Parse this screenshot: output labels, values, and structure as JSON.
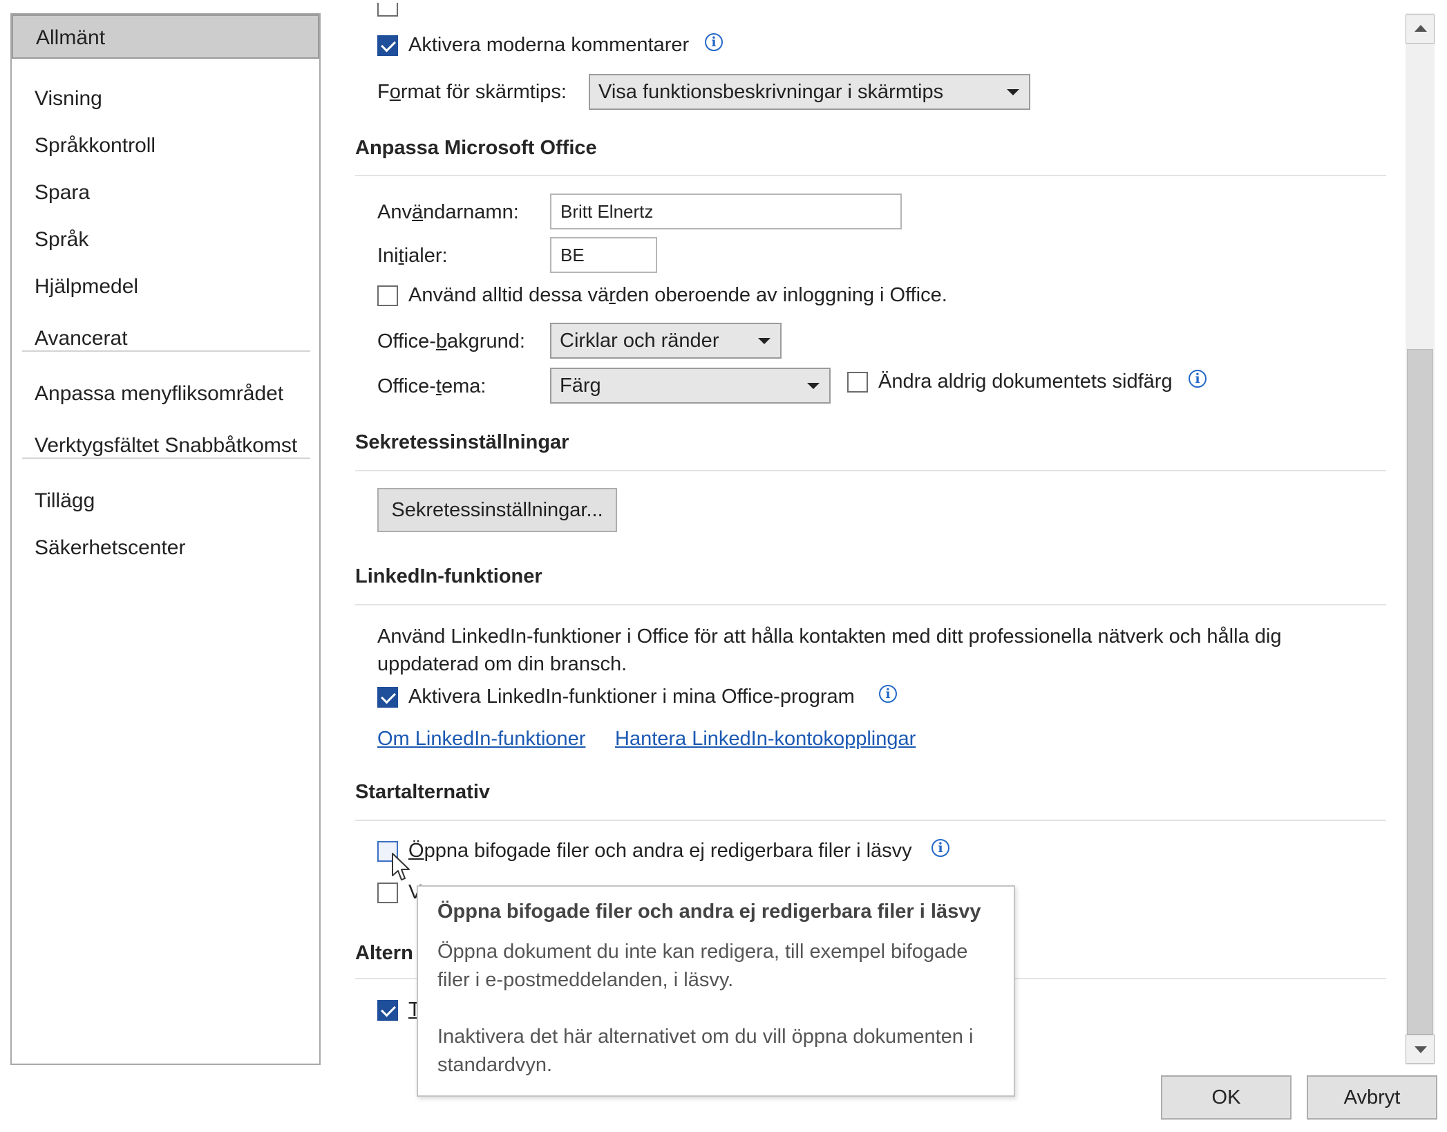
{
  "sidebar": {
    "items": [
      {
        "label": "Allmänt"
      },
      {
        "label": "Visning"
      },
      {
        "label": "Språkkontroll"
      },
      {
        "label": "Spara"
      },
      {
        "label": "Språk"
      },
      {
        "label": "Hjälpmedel"
      },
      {
        "label": "Avancerat"
      },
      {
        "label": "Anpassa menyfliksområdet"
      },
      {
        "label": "Verktygsfältet Snabbåtkomst"
      },
      {
        "label": "Tillägg"
      },
      {
        "label": "Säkerhetscenter"
      }
    ],
    "active_index": 0
  },
  "top": {
    "modern_comments_label": "Aktivera moderna kommentarer",
    "modern_comments_checked": true,
    "screentip_label_pre": "F",
    "screentip_label_key": "o",
    "screentip_label_post": "rmat för skärmtips:",
    "screentip_value": "Visa funktionsbeskrivningar i skärmtips"
  },
  "personalize": {
    "title": "Anpassa Microsoft Office",
    "username_pre": "Anv",
    "username_key": "ä",
    "username_post": "ndarnamn:",
    "username_value": "Britt Elnertz",
    "initials_pre": "Ini",
    "initials_key": "t",
    "initials_post": "ialer:",
    "initials_value": "BE",
    "always_use_pre": "Använd alltid dessa vä",
    "always_use_key": "r",
    "always_use_post": "den oberoende av inloggning i Office.",
    "always_use_checked": false,
    "background_pre": "Office-",
    "background_key": "b",
    "background_post": "akgrund:",
    "background_value": "Cirklar och ränder",
    "theme_pre": "Office-",
    "theme_key": "t",
    "theme_post": "ema:",
    "theme_value": "Färg",
    "never_change_label": "Ändra aldrig dokumentets sidfärg",
    "never_change_checked": false
  },
  "privacy": {
    "title": "Sekretessinställningar",
    "button_label": "Sekretessinställningar..."
  },
  "linkedin": {
    "title": "LinkedIn-funktioner",
    "description_line1": "Använd LinkedIn-funktioner i Office för att hålla kontakten med ditt professionella nätverk och hålla dig",
    "description_line2": "uppdaterad om din bransch.",
    "enable_label": "Aktivera LinkedIn-funktioner i mina Office-program",
    "enable_checked": true,
    "link_about": "Om LinkedIn-funktioner",
    "link_manage": "Hantera LinkedIn-kontokopplingar"
  },
  "startup": {
    "title": "Startalternativ",
    "open_readonly_key": "Ö",
    "open_readonly_post": "ppna bifogade filer och andra ej redigerbara filer i läsvy",
    "open_readonly_checked": false,
    "second_option_partial": "V",
    "second_option_checked": false
  },
  "alternatives": {
    "title_partial": "Altern",
    "option_partial": "T",
    "option_checked": true
  },
  "tooltip": {
    "title": "Öppna bifogade filer och andra ej redigerbara filer i läsvy",
    "body_line1": "Öppna dokument du inte kan redigera, till exempel bifogade",
    "body_line2": "filer i e-postmeddelanden, i läsvy.",
    "body_line3": "Inaktivera det här alternativet om du vill öppna dokumenten i",
    "body_line4": "standardvyn."
  },
  "footer": {
    "ok_label": "OK",
    "cancel_label": "Avbryt"
  },
  "icons": {
    "info_glyph": "i"
  },
  "colors": {
    "checkbox_checked": "#1f4e9a",
    "link": "#1b59b3",
    "info_icon": "#2468c8"
  }
}
